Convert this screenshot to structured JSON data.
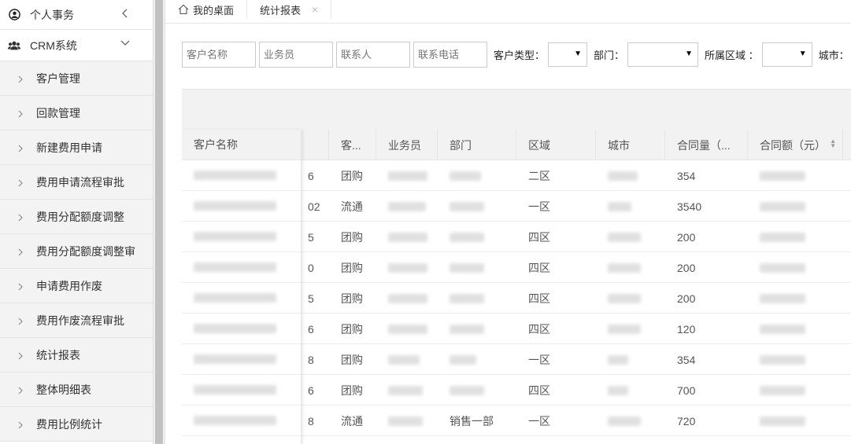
{
  "sidebar": {
    "groups": [
      {
        "label": "个人事务",
        "icon": "user-circle-icon",
        "chevron": "chevron-left-icon"
      },
      {
        "label": "CRM系统",
        "icon": "users-icon",
        "chevron": "chevron-down-icon"
      }
    ],
    "items": [
      {
        "label": "客户管理"
      },
      {
        "label": "回款管理"
      },
      {
        "label": "新建费用申请"
      },
      {
        "label": "费用申请流程审批"
      },
      {
        "label": "费用分配额度调整"
      },
      {
        "label": "费用分配额度调整审"
      },
      {
        "label": "申请费用作废"
      },
      {
        "label": "费用作废流程审批"
      },
      {
        "label": "统计报表"
      },
      {
        "label": "整体明细表"
      },
      {
        "label": "费用比例统计"
      }
    ]
  },
  "tabs": [
    {
      "label": "我的桌面",
      "icon": "home-icon"
    },
    {
      "label": "统计报表",
      "close": "×"
    }
  ],
  "filters": {
    "customer_name_placeholder": "客户名称",
    "salesman_placeholder": "业务员",
    "contact_placeholder": "联系人",
    "phone_placeholder": "联系电话",
    "customer_type_label": "客户类型：",
    "dept_label": "部门：",
    "region_label": "所属区域 ：",
    "city_label": "城市："
  },
  "table": {
    "headers": [
      "客户名称",
      "客...",
      "业务员",
      "部门",
      "区域",
      "城市",
      "合同量（...",
      "合同额（元）"
    ],
    "rows": [
      {
        "code": "6",
        "type": "团购",
        "region": "二区",
        "qty": "354",
        "dept": ""
      },
      {
        "code": "02",
        "type": "流通",
        "region": "一区",
        "qty": "3540",
        "dept": ""
      },
      {
        "code": "5",
        "type": "团购",
        "region": "四区",
        "qty": "200",
        "dept": ""
      },
      {
        "code": "0",
        "type": "团购",
        "region": "四区",
        "qty": "200",
        "dept": ""
      },
      {
        "code": "5",
        "type": "团购",
        "region": "四区",
        "qty": "200",
        "dept": ""
      },
      {
        "code": "6",
        "type": "团购",
        "region": "四区",
        "qty": "120",
        "dept": ""
      },
      {
        "code": "8",
        "type": "团购",
        "region": "一区",
        "qty": "354",
        "dept": ""
      },
      {
        "code": "6",
        "type": "团购",
        "region": "四区",
        "qty": "700",
        "dept": ""
      },
      {
        "code": "8",
        "type": "流通",
        "region": "一区",
        "qty": "720",
        "dept": "销售一部"
      }
    ]
  }
}
